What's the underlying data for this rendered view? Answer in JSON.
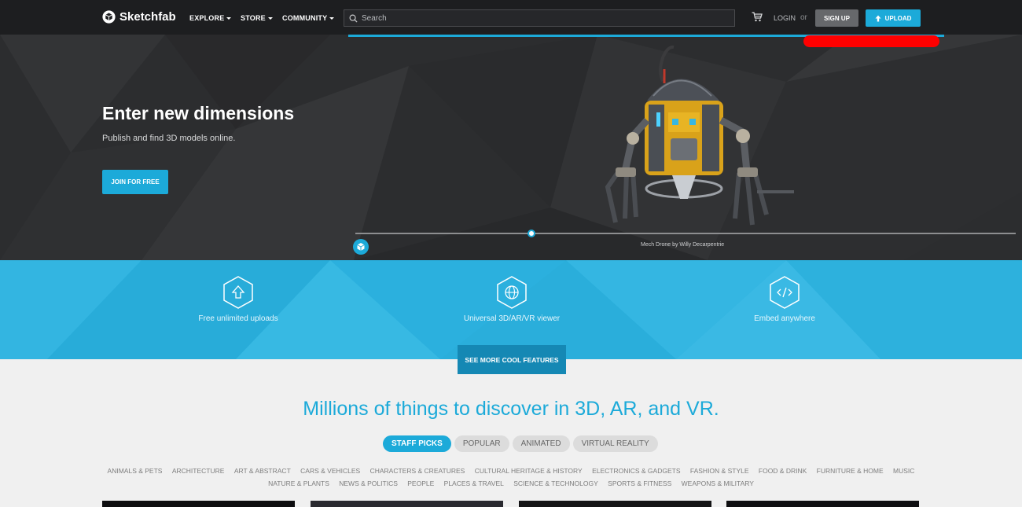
{
  "nav": {
    "brand": "Sketchfab",
    "links": [
      "EXPLORE",
      "STORE",
      "COMMUNITY"
    ],
    "search_placeholder": "Search",
    "login": "LOGIN",
    "or": "or",
    "signup": "SIGN UP",
    "upload": "UPLOAD"
  },
  "hero": {
    "title": "Enter new dimensions",
    "subtitle": "Publish and find 3D models online.",
    "cta": "JOIN FOR FREE",
    "caption": "Mech Drone by Willy Decarpentrie"
  },
  "features": {
    "items": [
      {
        "label": "Free unlimited uploads",
        "icon": "upload-icon"
      },
      {
        "label": "Universal 3D/AR/VR viewer",
        "icon": "globe-icon"
      },
      {
        "label": "Embed anywhere",
        "icon": "code-icon"
      }
    ],
    "more": "SEE MORE COOL FEATURES"
  },
  "discover": {
    "title": "Millions of things to discover in 3D, AR, and VR.",
    "tabs": [
      "STAFF PICKS",
      "POPULAR",
      "ANIMATED",
      "VIRTUAL REALITY"
    ],
    "categories_row1": [
      "ANIMALS & PETS",
      "ARCHITECTURE",
      "ART & ABSTRACT",
      "CARS & VEHICLES",
      "CHARACTERS & CREATURES",
      "CULTURAL HERITAGE & HISTORY",
      "ELECTRONICS & GADGETS",
      "FASHION & STYLE",
      "FOOD & DRINK",
      "FURNITURE & HOME",
      "MUSIC"
    ],
    "categories_row2": [
      "NATURE & PLANTS",
      "NEWS & POLITICS",
      "PEOPLE",
      "PLACES & TRAVEL",
      "SCIENCE & TECHNOLOGY",
      "SPORTS & FITNESS",
      "WEAPONS & MILITARY"
    ]
  },
  "colors": {
    "accent": "#1caad9",
    "nav_bg": "#1d1e20",
    "hero_bg": "#2c2d2f",
    "features_bg": "#2bb0de",
    "highlight": "#ff0000"
  }
}
